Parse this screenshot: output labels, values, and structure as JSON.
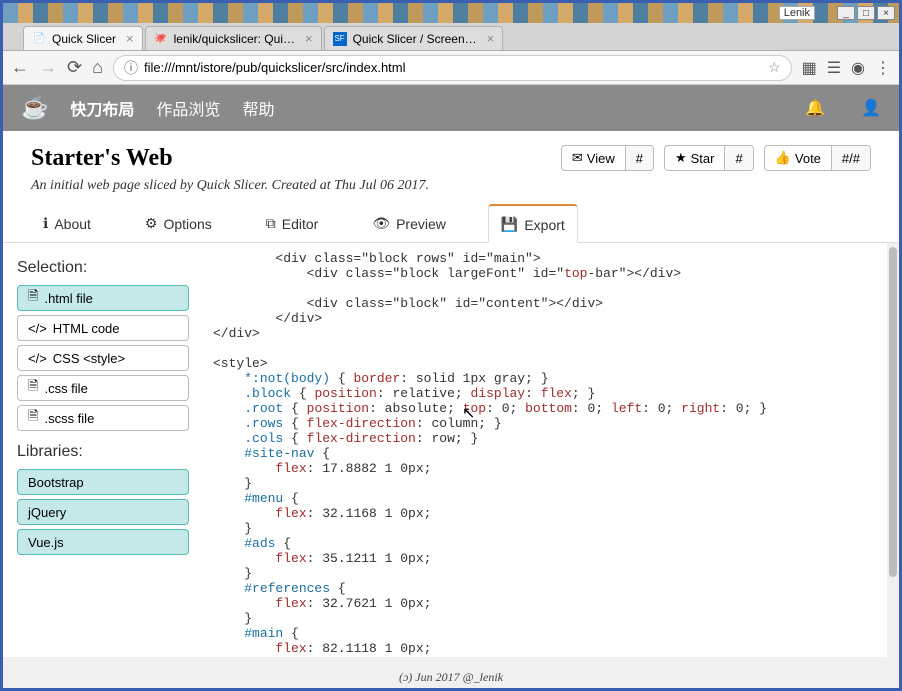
{
  "os": {
    "label": "Lenik",
    "min": "_",
    "max": "□",
    "close": "×"
  },
  "browserTabs": [
    {
      "title": "Quick Slicer",
      "active": true
    },
    {
      "title": "lenik/quickslicer: Qui…",
      "active": false
    },
    {
      "title": "Quick Slicer / Screen…",
      "active": false
    }
  ],
  "addressBar": {
    "url": "file:///mnt/istore/pub/quickslicer/src/index.html",
    "scheme": "ⓘ"
  },
  "header": {
    "menu": [
      "快刀布局",
      "作品浏览",
      "帮助"
    ]
  },
  "project": {
    "title": "Starter's Web",
    "subtitle": "An initial web page sliced by Quick Slicer. Created at Thu Jul 06 2017."
  },
  "actions": {
    "view": "View",
    "viewCount": "#",
    "star": "Star",
    "starCount": "#",
    "vote": "Vote",
    "voteCount": "#/#"
  },
  "tabs": [
    {
      "icon": "ℹ",
      "label": "About"
    },
    {
      "icon": "⚙",
      "label": "Options"
    },
    {
      "icon": "⧉",
      "label": "Editor"
    },
    {
      "icon": "👁",
      "label": "Preview"
    },
    {
      "icon": "💾",
      "label": "Export",
      "active": true
    }
  ],
  "sidebar": {
    "selectionLabel": "Selection:",
    "selection": [
      {
        "icon": "🗎",
        "label": ".html file",
        "active": true
      },
      {
        "icon": "</>",
        "label": "HTML code"
      },
      {
        "icon": "</>",
        "label": "CSS <style>"
      },
      {
        "icon": "🗎",
        "label": ".css file"
      },
      {
        "icon": "🗎",
        "label": ".scss file"
      }
    ],
    "librariesLabel": "Libraries:",
    "libraries": [
      {
        "label": "Bootstrap",
        "active": true
      },
      {
        "label": "jQuery",
        "active": true
      },
      {
        "label": "Vue.js",
        "active": true
      }
    ]
  },
  "code": "        <div class=\"block rows\" id=\"main\">\n            <div class=\"block largeFont\" id=\"top-bar\"></div>\n\n            <div class=\"block\" id=\"content\"></div>\n        </div>\n</div>\n\n<style>\n    *:not(body) { border: solid 1px gray; }\n    .block { position: relative; display: flex; }\n    .root { position: absolute; top: 0; bottom: 0; left: 0; right: 0; }\n    .rows { flex-direction: column; }\n    .cols { flex-direction: row; }\n    #site-nav {\n        flex: 17.8882 1 0px;\n    }\n    #menu {\n        flex: 32.1168 1 0px;\n    }\n    #ads {\n        flex: 35.1211 1 0px;\n    }\n    #references {\n        flex: 32.7621 1 0px;\n    }\n    #main {\n        flex: 82.1118 1 0px;",
  "footer": "(ɔ) Jun 2017 @_lenik"
}
